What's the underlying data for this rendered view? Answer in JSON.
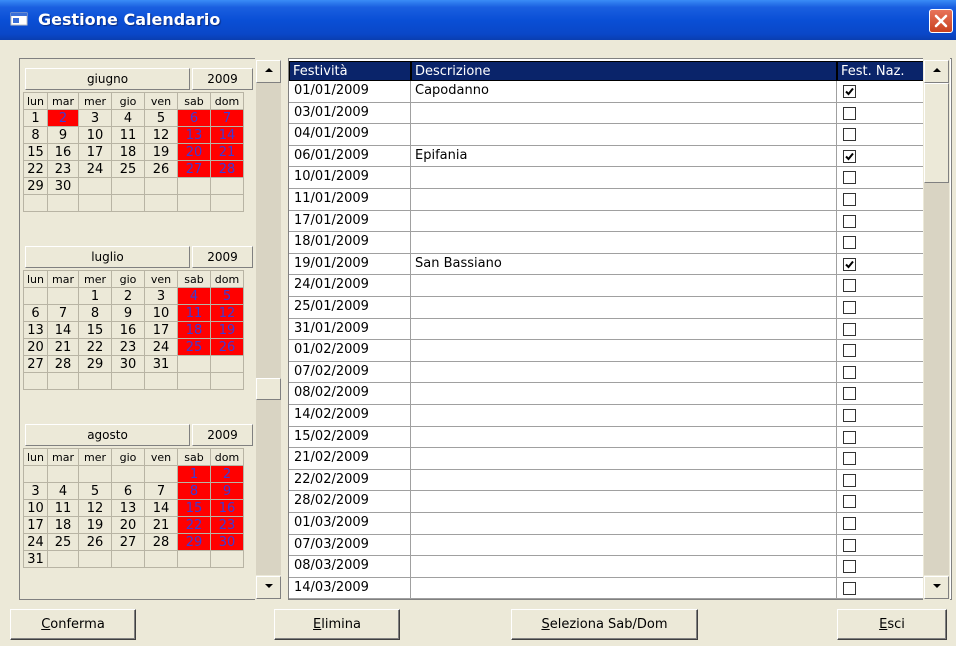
{
  "window": {
    "title": "Gestione Calendario"
  },
  "months": [
    {
      "name": "giugno",
      "year": "2009",
      "dow": [
        "lun",
        "mar",
        "mer",
        "gio",
        "ven",
        "sab",
        "dom"
      ],
      "weeks": [
        [
          "1",
          "2",
          "3",
          "4",
          "5",
          "6",
          "7"
        ],
        [
          "8",
          "9",
          "10",
          "11",
          "12",
          "13",
          "14"
        ],
        [
          "15",
          "16",
          "17",
          "18",
          "19",
          "20",
          "21"
        ],
        [
          "22",
          "23",
          "24",
          "25",
          "26",
          "27",
          "28"
        ],
        [
          "29",
          "30",
          "",
          "",
          "",
          "",
          ""
        ],
        [
          "",
          "",
          "",
          "",
          "",
          "",
          ""
        ]
      ],
      "red": [
        [
          0,
          1
        ],
        [
          0,
          5
        ],
        [
          0,
          6
        ],
        [
          1,
          5
        ],
        [
          1,
          6
        ],
        [
          2,
          5
        ],
        [
          2,
          6
        ],
        [
          3,
          5
        ],
        [
          3,
          6
        ]
      ]
    },
    {
      "name": "luglio",
      "year": "2009",
      "dow": [
        "lun",
        "mar",
        "mer",
        "gio",
        "ven",
        "sab",
        "dom"
      ],
      "weeks": [
        [
          "",
          "",
          "1",
          "2",
          "3",
          "4",
          "5"
        ],
        [
          "6",
          "7",
          "8",
          "9",
          "10",
          "11",
          "12"
        ],
        [
          "13",
          "14",
          "15",
          "16",
          "17",
          "18",
          "19"
        ],
        [
          "20",
          "21",
          "22",
          "23",
          "24",
          "25",
          "26"
        ],
        [
          "27",
          "28",
          "29",
          "30",
          "31",
          "",
          ""
        ],
        [
          "",
          "",
          "",
          "",
          "",
          "",
          ""
        ]
      ],
      "red": [
        [
          0,
          5
        ],
        [
          0,
          6
        ],
        [
          1,
          5
        ],
        [
          1,
          6
        ],
        [
          2,
          5
        ],
        [
          2,
          6
        ],
        [
          3,
          5
        ],
        [
          3,
          6
        ]
      ]
    },
    {
      "name": "agosto",
      "year": "2009",
      "dow": [
        "lun",
        "mar",
        "mer",
        "gio",
        "ven",
        "sab",
        "dom"
      ],
      "weeks": [
        [
          "",
          "",
          "",
          "",
          "",
          "1",
          "2"
        ],
        [
          "3",
          "4",
          "5",
          "6",
          "7",
          "8",
          "9"
        ],
        [
          "10",
          "11",
          "12",
          "13",
          "14",
          "15",
          "16"
        ],
        [
          "17",
          "18",
          "19",
          "20",
          "21",
          "22",
          "23"
        ],
        [
          "24",
          "25",
          "26",
          "27",
          "28",
          "29",
          "30"
        ],
        [
          "31",
          "",
          "",
          "",
          "",
          "",
          ""
        ]
      ],
      "red": [
        [
          0,
          5
        ],
        [
          0,
          6
        ],
        [
          1,
          5
        ],
        [
          1,
          6
        ],
        [
          2,
          5
        ],
        [
          2,
          6
        ],
        [
          3,
          5
        ],
        [
          3,
          6
        ],
        [
          4,
          5
        ],
        [
          4,
          6
        ]
      ]
    }
  ],
  "grid": {
    "headers": {
      "date": "Festività",
      "desc": "Descrizione",
      "naz": "Fest. Naz."
    },
    "rows": [
      {
        "date": "01/01/2009",
        "desc": "Capodanno",
        "naz": true
      },
      {
        "date": "03/01/2009",
        "desc": "",
        "naz": false
      },
      {
        "date": "04/01/2009",
        "desc": "",
        "naz": false
      },
      {
        "date": "06/01/2009",
        "desc": "Epifania",
        "naz": true
      },
      {
        "date": "10/01/2009",
        "desc": "",
        "naz": false
      },
      {
        "date": "11/01/2009",
        "desc": "",
        "naz": false
      },
      {
        "date": "17/01/2009",
        "desc": "",
        "naz": false
      },
      {
        "date": "18/01/2009",
        "desc": "",
        "naz": false
      },
      {
        "date": "19/01/2009",
        "desc": "San Bassiano",
        "naz": true
      },
      {
        "date": "24/01/2009",
        "desc": "",
        "naz": false
      },
      {
        "date": "25/01/2009",
        "desc": "",
        "naz": false
      },
      {
        "date": "31/01/2009",
        "desc": "",
        "naz": false
      },
      {
        "date": "01/02/2009",
        "desc": "",
        "naz": false
      },
      {
        "date": "07/02/2009",
        "desc": "",
        "naz": false
      },
      {
        "date": "08/02/2009",
        "desc": "",
        "naz": false
      },
      {
        "date": "14/02/2009",
        "desc": "",
        "naz": false
      },
      {
        "date": "15/02/2009",
        "desc": "",
        "naz": false
      },
      {
        "date": "21/02/2009",
        "desc": "",
        "naz": false
      },
      {
        "date": "22/02/2009",
        "desc": "",
        "naz": false
      },
      {
        "date": "28/02/2009",
        "desc": "",
        "naz": false
      },
      {
        "date": "01/03/2009",
        "desc": "",
        "naz": false
      },
      {
        "date": "07/03/2009",
        "desc": "",
        "naz": false
      },
      {
        "date": "08/03/2009",
        "desc": "",
        "naz": false
      },
      {
        "date": "14/03/2009",
        "desc": "",
        "naz": false
      }
    ]
  },
  "buttons": {
    "conferma": {
      "access": "C",
      "rest": "onferma"
    },
    "elimina": {
      "access": "E",
      "rest": "limina"
    },
    "seleziona": {
      "access": "S",
      "rest": "eleziona Sab/Dom"
    },
    "esci": {
      "access": "E",
      "rest": "sci"
    }
  },
  "icons": {
    "close": "close-icon",
    "up": "arrow-up-icon",
    "down": "arrow-down-icon",
    "check": "checkmark-icon"
  },
  "colors": {
    "title_bar": "#0a4fd6",
    "weekend": "#ff0000",
    "weekend_text": "#3b3bd6",
    "header_bg": "#0a246a"
  }
}
